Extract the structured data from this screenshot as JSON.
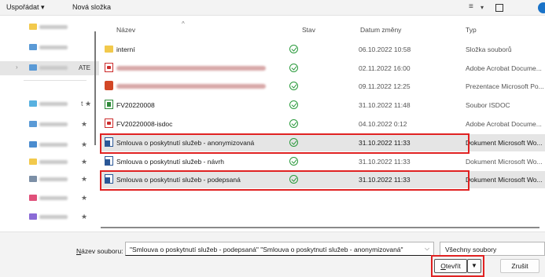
{
  "toolbar": {
    "organize_label": "Uspořádat ▾",
    "new_folder_label": "Nová složka",
    "view_icon": "list-view-icon",
    "pane_icon": "preview-pane-icon",
    "help_icon": "help-icon"
  },
  "nav": {
    "items": [
      {
        "icon": "star-icon",
        "color": "#f2c94c"
      },
      {
        "icon": "cloud-icon",
        "color": "#5a9ad6"
      },
      {
        "icon": "computer-icon",
        "color": "#5a9ad6",
        "text_suffix": "ATE"
      },
      {
        "icon": "folder-icon",
        "color": "#58b1e0",
        "pin": "t ★"
      },
      {
        "icon": "desktop-icon",
        "color": "#5a9ad6",
        "pin": "★"
      },
      {
        "icon": "download-icon",
        "color": "#4a8ccf",
        "pin": "★"
      },
      {
        "icon": "folder-icon",
        "color": "#f2c94c",
        "pin": "★"
      },
      {
        "icon": "documents-icon",
        "color": "#7c8fa6",
        "pin": "★"
      },
      {
        "icon": "music-icon",
        "color": "#e0507a",
        "pin": "★"
      },
      {
        "icon": "video-icon",
        "color": "#8a6ad6",
        "pin": "★"
      }
    ]
  },
  "columns": {
    "name": "Název",
    "status": "Stav",
    "date": "Datum změny",
    "type": "Typ"
  },
  "rows": [
    {
      "name": "interní",
      "date": "06.10.2022 10:58",
      "type": "Složka souborů",
      "icon": "folder-icon"
    },
    {
      "name": "",
      "date": "02.11.2022 16:00",
      "type": "Adobe Acrobat Docume...",
      "icon": "pdf-icon"
    },
    {
      "name": "",
      "date": "09.11.2022 12:25",
      "type": "Prezentace Microsoft Po...",
      "icon": "ppt-icon"
    },
    {
      "name": "FV20220008",
      "date": "31.10.2022 11:48",
      "type": "Soubor ISDOC",
      "icon": "isdoc-icon"
    },
    {
      "name": "FV20220008-isdoc",
      "date": "04.10.2022 0:12",
      "type": "Adobe Acrobat Docume...",
      "icon": "pdf-icon"
    },
    {
      "name": "Smlouva o poskytnutí služeb - anonymizovaná",
      "date": "31.10.2022 11:33",
      "type": "Dokument Microsoft Wo...",
      "icon": "word-icon"
    },
    {
      "name": "Smlouva o poskytnutí služeb - návrh",
      "date": "31.10.2022 11:33",
      "type": "Dokument Microsoft Wo...",
      "icon": "word-icon"
    },
    {
      "name": "Smlouva o poskytnutí služeb - podepsaná",
      "date": "31.10.2022 11:33",
      "type": "Dokument Microsoft Wo...",
      "icon": "word-icon"
    }
  ],
  "footer": {
    "filename_label_underlined": "N",
    "filename_label_rest": "ázev souboru:",
    "filename_value": "\"Smlouva o poskytnutí služeb - podepsaná\" \"Smlouva o poskytnutí služeb - anonymizovaná\"",
    "filetype_value": "Všechny soubory",
    "open_label_underlined": "O",
    "open_label_rest": "tevřít",
    "cancel_label": "Zrušit"
  },
  "colors": {
    "highlight": "#e5e5e5",
    "annotation_red": "#e02222",
    "status_green": "#2a9a3c",
    "help_blue": "#1a73c8"
  }
}
